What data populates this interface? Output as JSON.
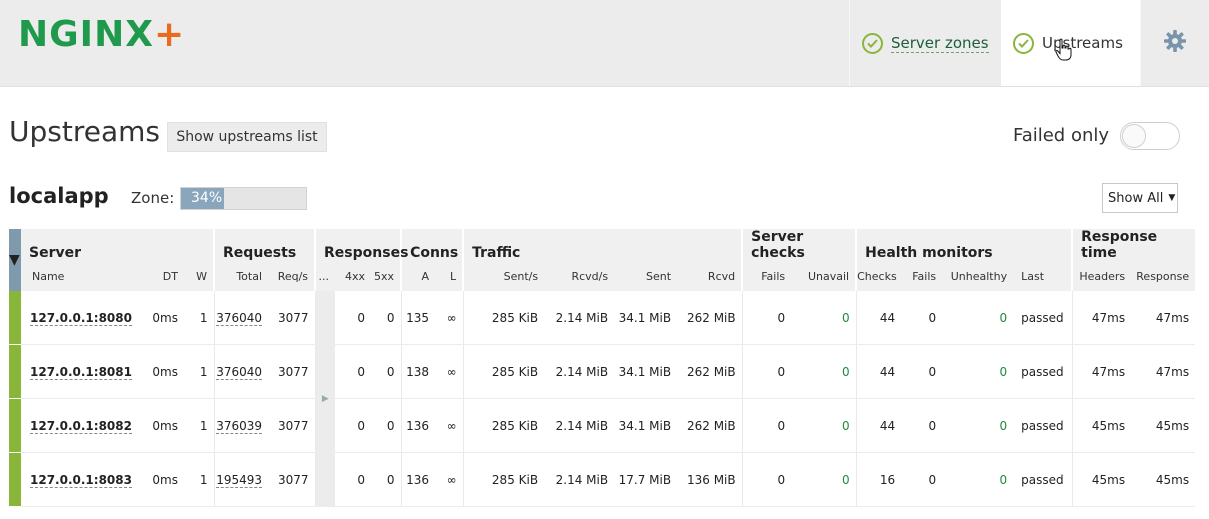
{
  "header": {
    "logo": {
      "main": "NGINX",
      "plus": "+"
    },
    "nav": [
      {
        "label": "Server zones",
        "icon": "check-circle-icon"
      },
      {
        "label": "Upstreams",
        "icon": "check-circle-icon",
        "active": true
      }
    ],
    "settings_icon": "gear-icon"
  },
  "page": {
    "title": "Upstreams",
    "list_button": "Show upstreams list",
    "failed_only_label": "Failed only",
    "failed_only_on": false
  },
  "upstream": {
    "name": "localapp",
    "zone_label": "Zone:",
    "zone_percent_text": "34%",
    "zone_fraction": 0.34,
    "show_select": "Show All"
  },
  "table": {
    "groups": {
      "server": "Server",
      "requests": "Requests",
      "responses": "Responses",
      "conns": "Conns",
      "traffic": "Traffic",
      "server_checks": "Server checks",
      "health_monitors": "Health monitors",
      "response_time": "Response time"
    },
    "columns": {
      "name": "Name",
      "dt": "DT",
      "w": "W",
      "total": "Total",
      "reqs": "Req/s",
      "dots": "...",
      "r4xx": "4xx",
      "r5xx": "5xx",
      "a": "A",
      "l": "L",
      "sent_s": "Sent/s",
      "rcvd_s": "Rcvd/s",
      "sent": "Sent",
      "rcvd": "Rcvd",
      "fails": "Fails",
      "unavail": "Unavail",
      "checks": "Checks",
      "hm_fails": "Fails",
      "unhealthy": "Unhealthy",
      "last": "Last",
      "headers": "Headers",
      "response": "Response"
    },
    "rows": [
      {
        "name": "127.0.0.1:8080",
        "dt": "0ms",
        "w": "1",
        "total": "376040",
        "reqs": "3077",
        "r4xx": "0",
        "r5xx": "0",
        "a": "135",
        "l": "∞",
        "sent_s": "285 KiB",
        "rcvd_s": "2.14 MiB",
        "sent": "34.1 MiB",
        "rcvd": "262 MiB",
        "fails": "0",
        "unavail": "0",
        "checks": "44",
        "hm_fails": "0",
        "unhealthy": "0",
        "last": "passed",
        "headers": "47ms",
        "response": "47ms"
      },
      {
        "name": "127.0.0.1:8081",
        "dt": "0ms",
        "w": "1",
        "total": "376040",
        "reqs": "3077",
        "r4xx": "0",
        "r5xx": "0",
        "a": "138",
        "l": "∞",
        "sent_s": "285 KiB",
        "rcvd_s": "2.14 MiB",
        "sent": "34.1 MiB",
        "rcvd": "262 MiB",
        "fails": "0",
        "unavail": "0",
        "checks": "44",
        "hm_fails": "0",
        "unhealthy": "0",
        "last": "passed",
        "headers": "47ms",
        "response": "47ms"
      },
      {
        "name": "127.0.0.1:8082",
        "dt": "0ms",
        "w": "1",
        "total": "376039",
        "reqs": "3077",
        "r4xx": "0",
        "r5xx": "0",
        "a": "136",
        "l": "∞",
        "sent_s": "285 KiB",
        "rcvd_s": "2.14 MiB",
        "sent": "34.1 MiB",
        "rcvd": "262 MiB",
        "fails": "0",
        "unavail": "0",
        "checks": "44",
        "hm_fails": "0",
        "unhealthy": "0",
        "last": "passed",
        "headers": "45ms",
        "response": "45ms"
      },
      {
        "name": "127.0.0.1:8083",
        "dt": "0ms",
        "w": "1",
        "total": "195493",
        "reqs": "3077",
        "r4xx": "0",
        "r5xx": "0",
        "a": "136",
        "l": "∞",
        "sent_s": "285 KiB",
        "rcvd_s": "2.14 MiB",
        "sent": "17.7 MiB",
        "rcvd": "136 MiB",
        "fails": "0",
        "unavail": "0",
        "checks": "16",
        "hm_fails": "0",
        "unhealthy": "0",
        "last": "passed",
        "headers": "45ms",
        "response": "45ms"
      }
    ]
  },
  "colors": {
    "brand_green": "#1f9a4c",
    "brand_orange": "#e86b1f",
    "status_ok": "#8ab53b",
    "zone_fill": "#8aa6bd"
  }
}
